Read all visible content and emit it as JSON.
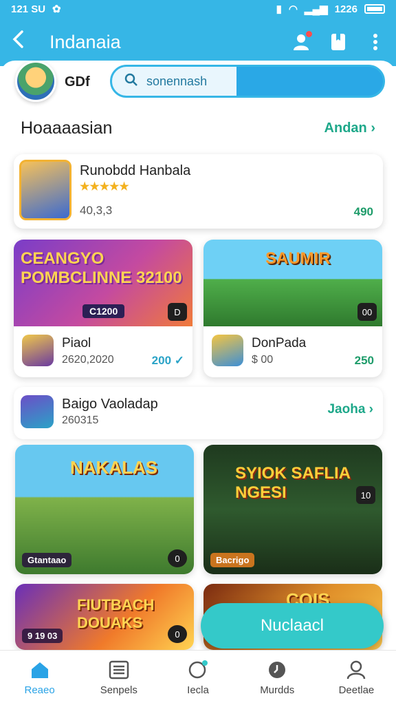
{
  "status": {
    "time": "121 SU",
    "battery": "1226"
  },
  "app_bar": {
    "title": "Indanaia"
  },
  "profile": {
    "name": "GDf",
    "search_placeholder": "sonennash"
  },
  "section1": {
    "title": "Hoaaaasian",
    "see_all": "Andan"
  },
  "featured": {
    "title": "Runobdd Hanbala",
    "rating": "★★★★★",
    "meta": "40,3,3",
    "price": "490"
  },
  "grid1": [
    {
      "banner_title": "CEANGYO POMBCLINNE 32100",
      "banner_sub": "C1200",
      "title": "Piaol",
      "meta": "2620,2020",
      "price": "200 ✓",
      "badge": "D"
    },
    {
      "banner_title": "SAUMIR",
      "banner_sub": "",
      "title": "DonPada",
      "meta": "$ 00",
      "price": "250",
      "badge": "00"
    }
  ],
  "list_item": {
    "title": "Baigo Vaoladap",
    "meta": "260315",
    "see": "Jaoha"
  },
  "grid2": [
    {
      "title": "NAKALAS",
      "sub": "Gtantaao",
      "badge": "0"
    },
    {
      "title": "SYIOK SAFLIA NGESI",
      "sub": "Bacrigo",
      "badge": "10"
    },
    {
      "title": "FIUTBACH DOUAKS",
      "sub": "9 19 03",
      "badge": "0"
    },
    {
      "title": "COIS",
      "sub": "",
      "badge": ""
    }
  ],
  "fab": {
    "label": "Nuclaacl"
  },
  "nav": [
    {
      "label": "Reaeo",
      "icon": "home-icon"
    },
    {
      "label": "Senpels",
      "icon": "list-icon"
    },
    {
      "label": "Iecla",
      "icon": "search-icon"
    },
    {
      "label": "Murdds",
      "icon": "clock-icon"
    },
    {
      "label": "Deetlae",
      "icon": "person-icon"
    }
  ],
  "colors": {
    "accent": "#36b6e6",
    "teal": "#34c9c9",
    "green": "#1ea88a"
  }
}
